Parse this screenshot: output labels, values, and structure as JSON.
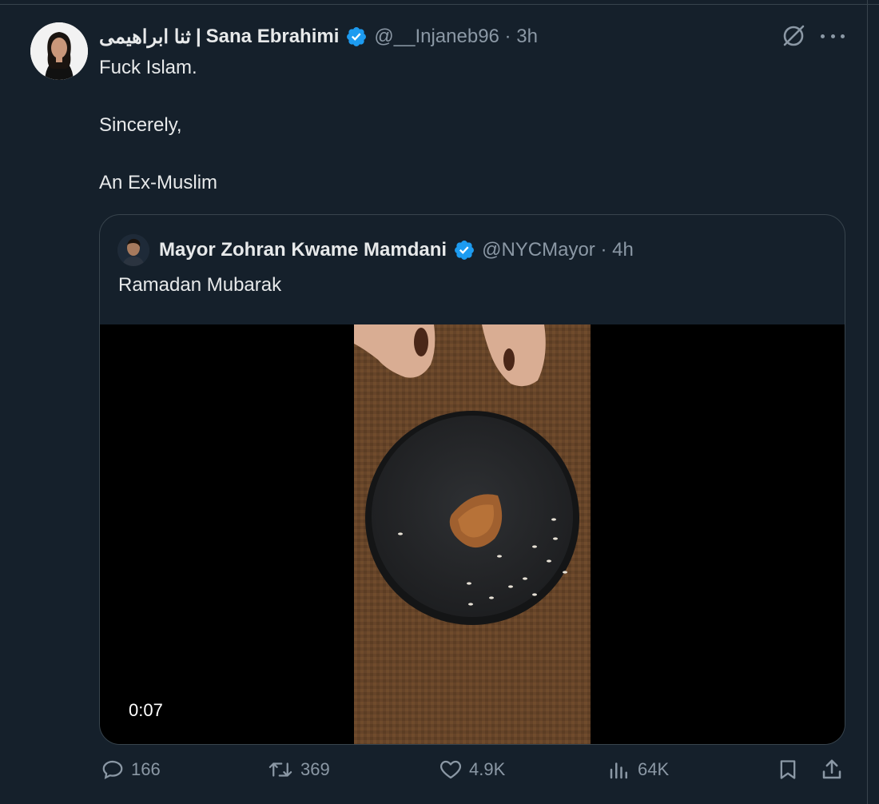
{
  "tweet": {
    "author_name_arabic": "ثنا ابراهیمی",
    "author_separator": "|",
    "author_name": "Sana Ebrahimi",
    "handle": "@__Injaneb96",
    "time": "3h",
    "text_lines": [
      "Fuck Islam.",
      "Sincerely,",
      "An Ex-Muslim"
    ]
  },
  "quoted_tweet": {
    "author_name": "Mayor Zohran Kwame Mamdani",
    "handle": "@NYCMayor",
    "time": "4h",
    "text": "Ramadan Mubarak",
    "video_duration": "0:07"
  },
  "actions": {
    "replies": "166",
    "reposts": "369",
    "likes": "4.9K",
    "views": "64K"
  },
  "colors": {
    "background": "#15202b",
    "verified": "#1d9bf0",
    "muted": "#8b98a5"
  }
}
